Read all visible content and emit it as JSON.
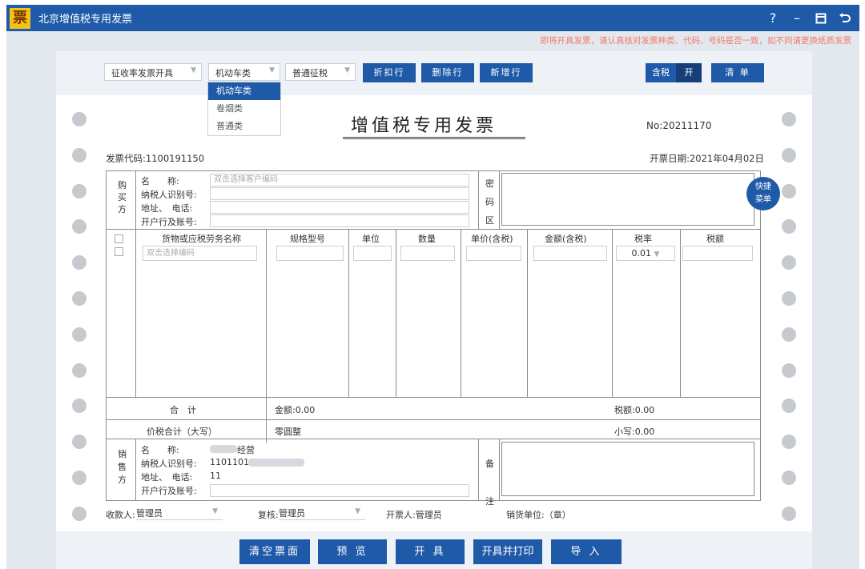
{
  "window": {
    "logo": "票",
    "title": "北京增值税专用发票",
    "help": "?",
    "minimize": "–"
  },
  "notice": "即将开具发票，请认真核对发票种类、代码、号码是否一致，如不同请更换纸质发票",
  "toolbar": {
    "mode_select": "征收率发票开具",
    "category_select": "机动车类",
    "levy_select": "普通征税",
    "discount_btn": "折扣行",
    "delete_btn": "删除行",
    "add_btn": "新增行",
    "tax_incl_label": "含税",
    "tax_incl_state": "开",
    "list_btn": "清 单"
  },
  "dropdown": {
    "options": [
      "机动车类",
      "卷烟类",
      "普通类"
    ],
    "selected": "机动车类"
  },
  "invoice": {
    "title": "增值税专用发票",
    "no_label": "No:",
    "no_value": "20211170",
    "code_label": "发票代码:",
    "code_value": "1100191150",
    "date_label": "开票日期:",
    "date_value": "2021年04月02日"
  },
  "buyer": {
    "section": [
      "购",
      "买",
      "方"
    ],
    "name_label": "名　　称:",
    "name_placeholder": "双击选择客户编码",
    "taxid_label": "纳税人识别号:",
    "addr_label": "地址、　电话:",
    "bank_label": "开户行及账号:",
    "cipher": [
      "密",
      "码",
      "区"
    ]
  },
  "items": {
    "headers": [
      "货物或应税劳务名称",
      "规格型号",
      "单位",
      "数量",
      "单价(含税)",
      "金额(含税)",
      "税率",
      "税额"
    ],
    "name_placeholder": "双击选择编码",
    "tax_rate": "0.01"
  },
  "totals": {
    "sum_label": "合　计",
    "amount": "金额:0.00",
    "tax": "税额:0.00",
    "total_label": "价税合计（大写）",
    "total_upper": "零圆整",
    "total_lower": "小写:0.00"
  },
  "seller": {
    "section": [
      "销",
      "售",
      "方"
    ],
    "name_label": "名　　称:",
    "name_value": "经营",
    "taxid_label": "纳税人识别号:",
    "taxid_value": "11011011",
    "addr_label": "地址、　电话:",
    "addr_value": "11",
    "bank_label": "开户行及账号:",
    "remark": [
      "备",
      "注"
    ]
  },
  "footer": {
    "payee_label": "收款人:",
    "payee_value": "管理员",
    "reviewer_label": "复核:",
    "reviewer_value": "管理员",
    "drawer": "开票人:管理员",
    "seller_unit": "销货单位:（章）"
  },
  "quick_menu": [
    "快捷",
    "菜单"
  ],
  "bottom_buttons": {
    "clear": "清空票面",
    "preview": "预 览",
    "issue": "开 具",
    "issue_print": "开具并打印",
    "import": "导 入"
  }
}
